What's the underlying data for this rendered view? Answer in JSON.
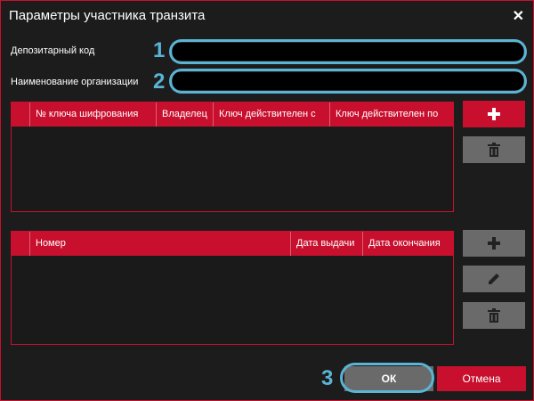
{
  "window": {
    "title": "Параметры участника транзита",
    "close_glyph": "✕"
  },
  "form": {
    "depository_code_label": "Депозитарный код",
    "depository_code_value": "",
    "organization_name_label": "Наименование организации",
    "organization_name_value": ""
  },
  "markers": {
    "one": "1",
    "two": "2",
    "three": "3"
  },
  "keys_table": {
    "columns": [
      "№ ключа шифрования",
      "Владелец",
      "Ключ действителен с",
      "Ключ действителен по"
    ],
    "rows": []
  },
  "documents_table": {
    "columns": [
      "Номер",
      "Дата выдачи",
      "Дата окончания"
    ],
    "rows": []
  },
  "buttons": {
    "ok": "ОК",
    "cancel": "Отмена"
  },
  "colors": {
    "accent": "#c8102e",
    "highlight": "#5ab4d6",
    "button_disabled": "#6a6a6a",
    "background": "#1c1c1c"
  },
  "icons": {
    "keys_add": "plus-icon",
    "keys_delete": "trash-icon",
    "docs_add": "plus-icon",
    "docs_edit": "pencil-icon",
    "docs_delete": "trash-icon"
  }
}
